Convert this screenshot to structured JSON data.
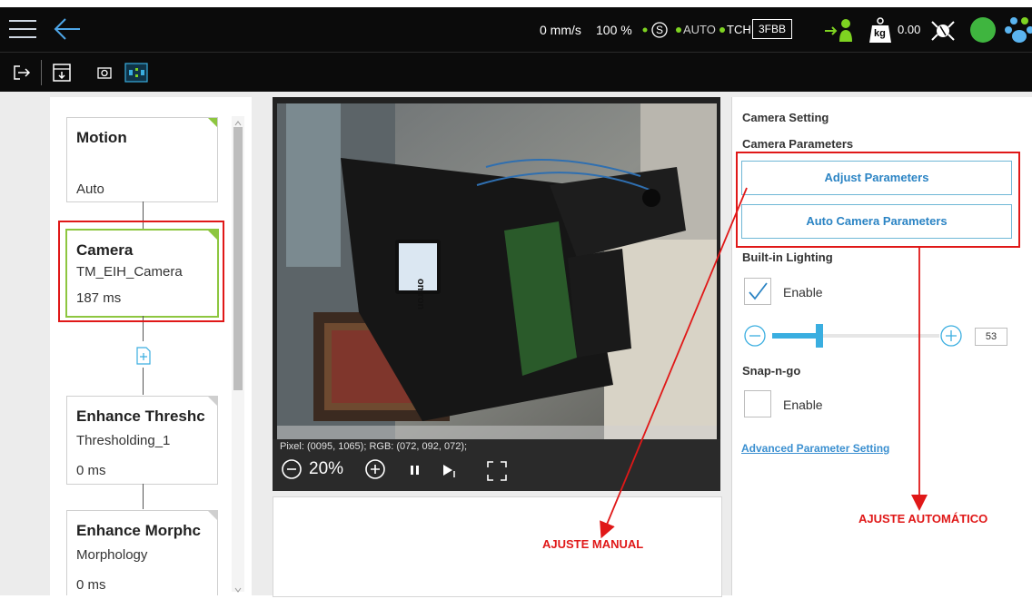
{
  "topbar": {
    "speed": "0 mm/s",
    "percent": "100 %",
    "mode_auto": "AUTO",
    "mode_tch": "TCH",
    "device_id": "3FBB",
    "payload_unit": "kg",
    "payload_value": "0.00"
  },
  "flow": {
    "nodes": [
      {
        "title": "Motion",
        "sub": "",
        "time": "Auto"
      },
      {
        "title": "Camera",
        "sub": "TM_EIH_Camera",
        "time": "187 ms"
      },
      {
        "title": "Enhance Threshc",
        "sub": "Thresholding_1",
        "time": "0 ms"
      },
      {
        "title": "Enhance Morphc",
        "sub": "Morphology",
        "time": "0 ms"
      }
    ]
  },
  "viewer": {
    "pixel_info": "Pixel: (0095, 1065); RGB: (072, 092, 072);",
    "zoom": "20%",
    "camera_logo": "omron"
  },
  "settings": {
    "section_title": "Camera Setting",
    "params_title": "Camera Parameters",
    "adjust_btn": "Adjust Parameters",
    "auto_btn": "Auto Camera Parameters",
    "lighting_title": "Built-in Lighting",
    "lighting_enable": "Enable",
    "lighting_checked": true,
    "lighting_value": "53",
    "lighting_level_fraction": 0.28,
    "snap_title": "Snap-n-go",
    "snap_enable": "Enable",
    "snap_checked": false,
    "advanced_link": "Advanced Parameter Setting"
  },
  "annotations": {
    "manual": "AJUSTE MANUAL",
    "auto": "AJUSTE AUTOMÁTICO",
    "color": "#e01818"
  }
}
